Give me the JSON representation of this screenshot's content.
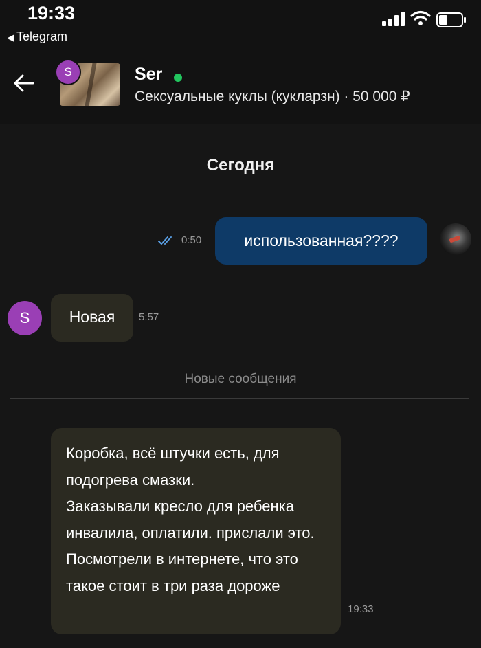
{
  "status_bar": {
    "time": "19:33",
    "back_app_label": "Telegram"
  },
  "chat_header": {
    "seller_initial": "S",
    "seller_name": "Ser",
    "online": true,
    "ad_line": "Сексуальные куклы (кукларзн) · 50 000 ₽"
  },
  "day_separator": "Сегодня",
  "messages": [
    {
      "direction": "outgoing",
      "text": "использованная????",
      "time": "0:50",
      "read": true
    },
    {
      "direction": "incoming",
      "sender_initial": "S",
      "text": "Новая",
      "time": "5:57"
    },
    {
      "direction": "incoming",
      "text": "Коробка, всё штучки есть, для подогрева смазки.\nЗаказывали кресло для ребенка инвалила, оплатили. прислали это. Посмотрели  в интернете, что это такое стоит в три раза дороже",
      "time": "19:33"
    }
  ],
  "new_messages_label": "Новые сообщения",
  "colors": {
    "background": "#161616",
    "outgoing_bubble": "#0e3a67",
    "incoming_bubble": "#2b2a21",
    "avatar": "#9a3fb5",
    "online": "#22c55e"
  },
  "icons": [
    "back-arrow-icon",
    "cellular-signal-icon",
    "wifi-icon",
    "battery-icon",
    "double-check-icon"
  ]
}
